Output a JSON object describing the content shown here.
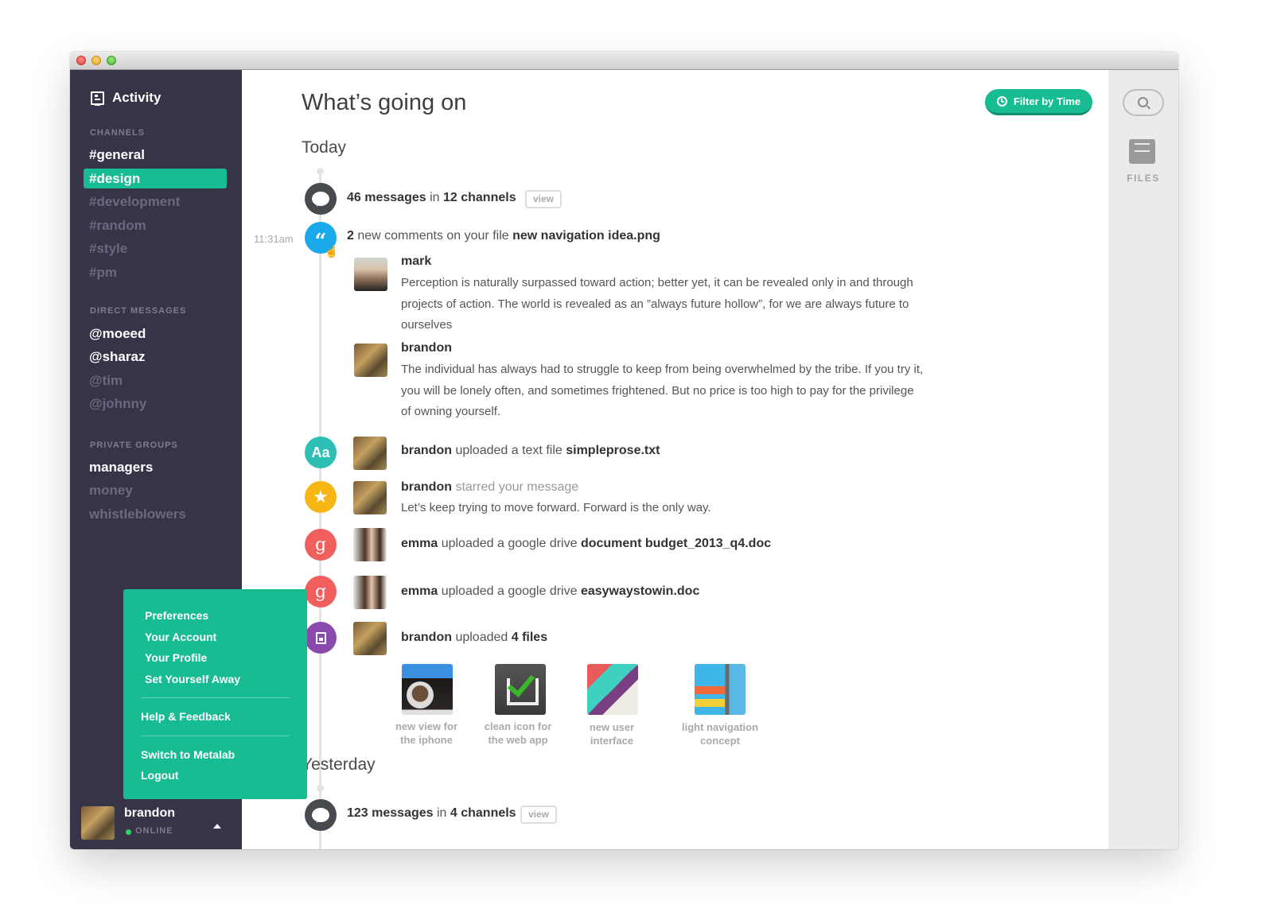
{
  "window": {
    "traffic_lights": [
      "close",
      "minimize",
      "zoom"
    ]
  },
  "sidebar": {
    "activity_label": "Activity",
    "channels_header": "CHANNELS",
    "channels": [
      {
        "label": "#general",
        "state": "bright"
      },
      {
        "label": "#design",
        "state": "active"
      },
      {
        "label": "#development",
        "state": "dim"
      },
      {
        "label": "#random",
        "state": "dim"
      },
      {
        "label": "#style",
        "state": "dim"
      },
      {
        "label": "#pm",
        "state": "dim"
      }
    ],
    "dm_header": "DIRECT MESSAGES",
    "direct_messages": [
      {
        "label": "@moeed",
        "state": "bright"
      },
      {
        "label": "@sharaz",
        "state": "bright"
      },
      {
        "label": "@tim",
        "state": "dim"
      },
      {
        "label": "@johnny",
        "state": "dim"
      }
    ],
    "groups_header": "PRIVATE GROUPS",
    "private_groups": [
      {
        "label": "managers",
        "state": "bright"
      },
      {
        "label": "money",
        "state": "dim"
      },
      {
        "label": "whistleblowers",
        "state": "dim"
      }
    ],
    "user": {
      "name": "brandon",
      "status": "ONLINE",
      "status_color": "#2fd36d"
    }
  },
  "popup_menu": {
    "group1": [
      "Preferences",
      "Your Account",
      "Your Profile",
      "Set Yourself Away"
    ],
    "group2": [
      "Help & Feedback"
    ],
    "group3": [
      "Switch to Metalab",
      "Logout"
    ]
  },
  "main": {
    "title": "What’s going on",
    "filter_button": "Filter by Time",
    "today_label": "Today",
    "yesterday_label": "Yesterday",
    "today_summary": {
      "count": "46 messages",
      "in": " in ",
      "channels": "12 channels",
      "view": "view"
    },
    "comment_event": {
      "time": "11:31am",
      "count": "2",
      "text": " new comments on your file ",
      "file": "new navigation idea.png",
      "comments": [
        {
          "author": "mark",
          "body": "Perception is naturally surpassed toward action; better yet, it can be revealed only in and through projects of action. The world is revealed as an ”always future hollow”, for we are always future to ourselves"
        },
        {
          "author": "brandon",
          "body": "The individual has always had to struggle to keep from being overwhelmed by the tribe. If you try it, you will be lonely often, and sometimes frightened. But no price is too high to pay for the privilege of owning yourself."
        }
      ]
    },
    "events": [
      {
        "user": "brandon",
        "action": " uploaded a text file ",
        "object": "simpleprose.txt",
        "icon": "Aa"
      },
      {
        "user": "brandon",
        "action": " starred your message",
        "quote": "Let’s keep trying to move forward. Forward is the only way."
      },
      {
        "user": "emma",
        "action": " uploaded a google drive ",
        "object": "document budget_2013_q4.doc",
        "icon": "g"
      },
      {
        "user": "emma",
        "action": " uploaded a google drive ",
        "object": "easywaystowin.doc",
        "icon": "g"
      },
      {
        "user": "brandon",
        "action": " uploaded ",
        "object": "4 files"
      }
    ],
    "files": [
      {
        "caption_line1": "new view for",
        "caption_line2": "the iphone"
      },
      {
        "caption_line1": "clean icon for",
        "caption_line2": "the web app"
      },
      {
        "caption_line1": "new user",
        "caption_line2": "interface"
      },
      {
        "caption_line1": "light navigation",
        "caption_line2": "concept"
      }
    ],
    "yesterday_summary": {
      "count": "123 messages",
      "in": " in ",
      "channels": "4 channels",
      "view": "view"
    }
  },
  "right_panel": {
    "files_label": "FILES"
  },
  "colors": {
    "accent": "#17bc92",
    "sidebar_bg": "#373448",
    "comment_blue": "#1aa9ea",
    "text_teal": "#2dbfb5",
    "star_amber": "#f7b614",
    "google_red": "#f05e5e",
    "files_purple": "#8a4aad"
  }
}
